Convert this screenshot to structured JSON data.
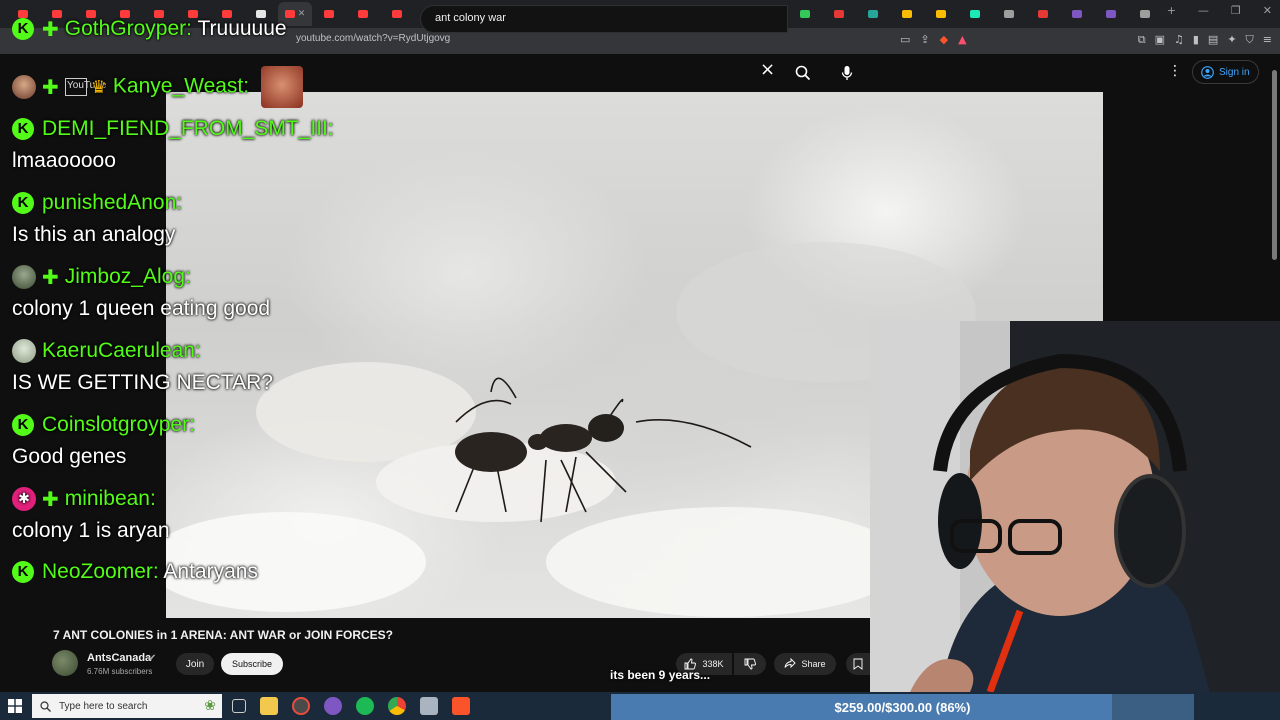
{
  "browser": {
    "url": "youtube.com/watch?v=RydUtjgovg",
    "tab_favicon_colors": [
      "#ff3b3b",
      "#ff3b3b",
      "#ff3b3b",
      "#ff3b3b",
      "#ff3b3b",
      "#ff3b3b",
      "#ff3b3b",
      "#e6e6e6",
      "#ff3b3b",
      "#ff3b3b",
      "#ff3b3b",
      "#ff3b3b",
      "#ff3b3b",
      "#ff3b3b",
      "#ff3b3b",
      "#ff3b3b",
      "#ff3b3b",
      "#ff3b3b",
      "#c13cc1",
      "#2e9bd6",
      "#f4b400",
      "#7e57c2",
      "#eeeeee",
      "#34c759",
      "#e53935",
      "#26a69a",
      "#fbbc04",
      "#fbbc04",
      "#1de9b6",
      "#9e9e9e",
      "#e53935",
      "#7e57c2",
      "#7e57c2",
      "#9e9e9e"
    ]
  },
  "youtube": {
    "search_value": "ant colony war",
    "signin_label": "Sign in",
    "video_title": "7 ANT COLONIES in 1 ARENA: ANT WAR or JOIN FORCES?",
    "channel_name": "AntsCanada",
    "subscribers": "6.76M subscribers",
    "join_label": "Join",
    "subscribe_label": "Subscribe",
    "like_count": "338K",
    "share_label": "Share",
    "caption": "its been 9 years..."
  },
  "chat": {
    "messages": [
      {
        "user": "GothGroyper:",
        "text": "Truuuuue"
      },
      {
        "user": "Kanye_Weast:",
        "text": ""
      },
      {
        "user": "DEMI_FIEND_FROM_SMT_III:",
        "text": "lmaaooooo"
      },
      {
        "user": "punishedAnon:",
        "text": "Is this an analogy"
      },
      {
        "user": "Jimboz_Alog:",
        "text": "colony 1 queen eating good"
      },
      {
        "user": "KaeruCaerulean:",
        "text": "IS WE GETTING NECTAR?"
      },
      {
        "user": "Coinslotgroyper:",
        "text": "Good genes"
      },
      {
        "user": "minibean:",
        "text": "colony 1 is aryan"
      },
      {
        "user": "NeoZoomer:",
        "text": "Antaryans"
      }
    ],
    "overlay_ghost_text": "YouTube",
    "badge_letter": "K"
  },
  "taskbar": {
    "search_placeholder": "Type here to search",
    "goal_text": "$259.00/$300.00 (86%)",
    "goal_fraction": 0.86
  },
  "colors": {
    "kick_green": "#53fc18",
    "youtube_blue": "#3ea6ff",
    "goal_bar": "#3a5f82"
  }
}
